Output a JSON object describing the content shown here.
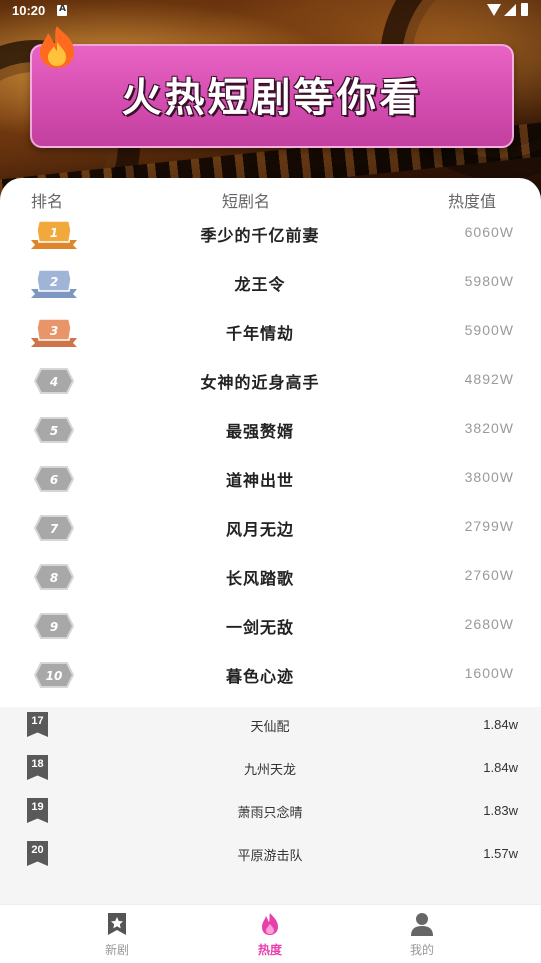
{
  "status_bar": {
    "time": "10:20"
  },
  "banner": {
    "title": "火热短剧等你看"
  },
  "ranking": {
    "headers": {
      "rank": "排名",
      "name": "短剧名",
      "heat": "热度值"
    },
    "items": [
      {
        "rank": "1",
        "name": "季少的千亿前妻",
        "heat": "6060W",
        "badge": "gold"
      },
      {
        "rank": "2",
        "name": "龙王令",
        "heat": "5980W",
        "badge": "silver"
      },
      {
        "rank": "3",
        "name": "千年情劫",
        "heat": "5900W",
        "badge": "bronze"
      },
      {
        "rank": "4",
        "name": "女神的近身高手",
        "heat": "4892W",
        "badge": "gray"
      },
      {
        "rank": "5",
        "name": "最强赘婿",
        "heat": "3820W",
        "badge": "gray"
      },
      {
        "rank": "6",
        "name": "道神出世",
        "heat": "3800W",
        "badge": "gray"
      },
      {
        "rank": "7",
        "name": "风月无边",
        "heat": "2799W",
        "badge": "gray"
      },
      {
        "rank": "8",
        "name": "长风踏歌",
        "heat": "2760W",
        "badge": "gray"
      },
      {
        "rank": "9",
        "name": "一剑无敌",
        "heat": "2680W",
        "badge": "gray"
      },
      {
        "rank": "10",
        "name": "暮色心迹",
        "heat": "1600W",
        "badge": "gray"
      }
    ]
  },
  "more_list": {
    "items": [
      {
        "rank": "17",
        "name": "天仙配",
        "heat": "1.84w"
      },
      {
        "rank": "18",
        "name": "九州天龙",
        "heat": "1.84w"
      },
      {
        "rank": "19",
        "name": "萧雨只念晴",
        "heat": "1.83w"
      },
      {
        "rank": "20",
        "name": "平原游击队",
        "heat": "1.57w"
      }
    ]
  },
  "bottom_nav": {
    "items": [
      {
        "label": "新剧",
        "icon": "star-bookmark-icon",
        "active": false
      },
      {
        "label": "热度",
        "icon": "flame-icon",
        "active": true
      },
      {
        "label": "我的",
        "icon": "person-icon",
        "active": false
      }
    ]
  },
  "colors": {
    "accent": "#e83fae",
    "banner": "#d44db0",
    "gold": "#f0a93a",
    "silver": "#9fb4d6",
    "bronze": "#e8956a",
    "gray_badge": "#a8a8a8",
    "bookmark": "#595959"
  }
}
